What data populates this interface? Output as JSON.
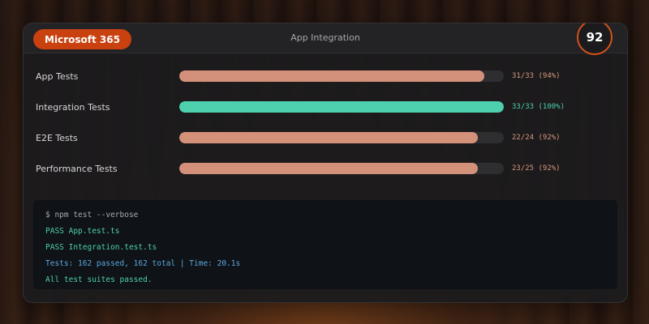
{
  "window": {
    "brand": "Microsoft 365",
    "title": "App Integration",
    "score": "92"
  },
  "colors": {
    "accent": "#c8410f",
    "bar_default": "#d4917a",
    "bar_success": "#4ecfad",
    "value_default": "#d8967e",
    "value_success": "#4ecfad",
    "term_prompt": "#a8aab0",
    "term_pass": "#4ecfad",
    "term_info": "#5aa8e0"
  },
  "test_rows": [
    {
      "label": "App Tests",
      "value": "31/33 (94%)",
      "fraction": 0.94,
      "status": "partial"
    },
    {
      "label": "Integration Tests",
      "value": "33/33 (100%)",
      "fraction": 1.0,
      "status": "success"
    },
    {
      "label": "E2E Tests",
      "value": "22/24 (92%)",
      "fraction": 0.92,
      "status": "partial"
    },
    {
      "label": "Performance Tests",
      "value": "23/25 (92%)",
      "fraction": 0.92,
      "status": "partial"
    }
  ],
  "terminal": {
    "lines": [
      {
        "text": "$ npm test --verbose",
        "kind": "prompt"
      },
      {
        "text": "PASS App.test.ts",
        "kind": "pass"
      },
      {
        "text": "PASS Integration.test.ts",
        "kind": "pass"
      },
      {
        "text": "Tests: 162 passed, 162 total | Time: 20.1s",
        "kind": "info"
      },
      {
        "text": "All test suites passed.",
        "kind": "pass"
      }
    ]
  }
}
